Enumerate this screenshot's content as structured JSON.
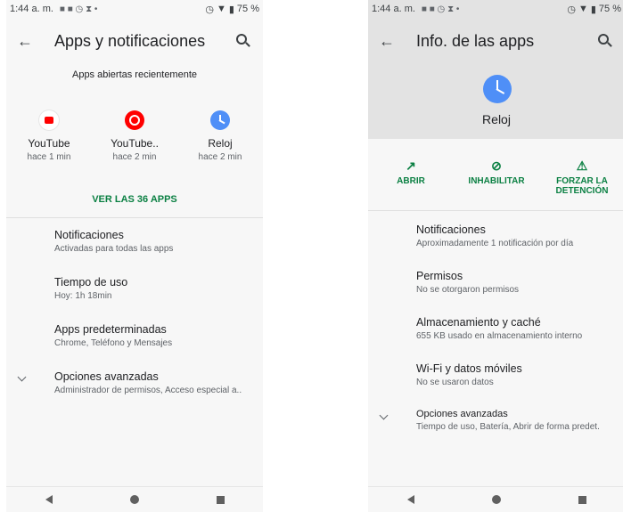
{
  "left": {
    "status": {
      "time": "1:44 a. m.",
      "battery": "75 %"
    },
    "title": "Apps y notificaciones",
    "recent_title": "Apps abiertas recientemente",
    "recent_apps": [
      {
        "name": "YouTube",
        "time": "hace 1 min",
        "icon": "youtube-icon"
      },
      {
        "name": "YouTube..",
        "time": "hace 2 min",
        "icon": "youtube-music-icon"
      },
      {
        "name": "Reloj",
        "time": "hace 2 min",
        "icon": "clock-icon"
      }
    ],
    "see_all": "VER LAS 36 APPS",
    "items": [
      {
        "title": "Notificaciones",
        "sub": "Activadas para todas las apps"
      },
      {
        "title": "Tiempo de uso",
        "sub": "Hoy: 1h 18min"
      },
      {
        "title": "Apps predeterminadas",
        "sub": "Chrome, Teléfono y Mensajes"
      },
      {
        "title": "Opciones avanzadas",
        "sub": "Administrador de permisos, Acceso especial a.."
      }
    ]
  },
  "right": {
    "status": {
      "time": "1:44 a. m.",
      "battery": "75 %"
    },
    "title": "Info. de las apps",
    "app_name": "Reloj",
    "actions": [
      {
        "label": "ABRIR",
        "icon": "open-external-icon"
      },
      {
        "label": "INHABILITAR",
        "icon": "disable-icon"
      },
      {
        "label": "FORZAR LA DETENCIÓN",
        "icon": "warning-icon"
      }
    ],
    "items": [
      {
        "title": "Notificaciones",
        "sub": "Aproximadamente 1 notificación por día"
      },
      {
        "title": "Permisos",
        "sub": "No se otorgaron permisos"
      },
      {
        "title": "Almacenamiento y caché",
        "sub": "655 KB usado en almacenamiento interno"
      },
      {
        "title": "Wi-Fi y datos móviles",
        "sub": "No se usaron datos"
      },
      {
        "title": "Opciones avanzadas",
        "sub": "Tiempo de uso, Batería, Abrir de forma predet."
      }
    ]
  },
  "colors": {
    "accent": "#0b8043",
    "header_bg": "#e3e3e3",
    "clock_blue": "#4f8ff7",
    "youtube_red": "#ff0000"
  }
}
